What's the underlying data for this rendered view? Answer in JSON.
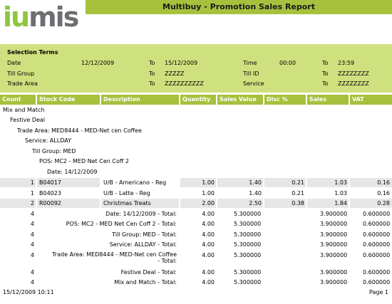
{
  "report": {
    "title": "Multibuy - Promotion Sales Report",
    "logo_part1": "iu",
    "logo_part2": "mis"
  },
  "selection": {
    "heading": "Selection Terms",
    "date_label": "Date",
    "date_from": "12/12/2009",
    "to1": "To",
    "date_to": "15/12/2009",
    "time_label": "Time",
    "time_from": "00:00",
    "to2": "To",
    "time_to": "23:59",
    "till_group_label": "Till Group",
    "to3": "To",
    "till_group_to": "ZZZZZ",
    "till_id_label": "Till ID",
    "to4": "To",
    "till_id_to": "ZZZZZZZZ",
    "trade_area_label": "Trade Area",
    "to5": "To",
    "trade_area_to": "ZZZZZZZZZZ",
    "service_label": "Service",
    "to6": "To",
    "service_to": "ZZZZZZZZ"
  },
  "columns": [
    "Count",
    "Stock Code",
    "Description",
    "Quantity",
    "Sales Value",
    "Disc %",
    "Sales",
    "VAT"
  ],
  "groups": {
    "g1": "Mix and Match",
    "g2": "Festive Deal",
    "g3": "Trade Area: MED8444 - MED-Net cen Coffee",
    "g4": "Service: ALLDAY",
    "g5": "Till Group: MED",
    "g6": "POS: MC2 - MED Net Cen Coff 2",
    "g7": "Date: 14/12/2009"
  },
  "items": [
    {
      "count": "1",
      "code": "B04017",
      "desc": "U/B - Americano - Reg",
      "qty": "1.00",
      "value": "1.40",
      "disc": "0.21",
      "sales": "1.03",
      "vat": "0.16"
    },
    {
      "count": "1",
      "code": "B04023",
      "desc": "U/B - Latte - Reg",
      "qty": "1.00",
      "value": "1.40",
      "disc": "0.21",
      "sales": "1.03",
      "vat": "0.16"
    },
    {
      "count": "2",
      "code": "R00092",
      "desc": "Christmas Treats",
      "qty": "2.00",
      "value": "2.50",
      "disc": "0.38",
      "sales": "1.84",
      "vat": "0.28"
    }
  ],
  "totals": [
    {
      "count": "4",
      "label": "Date: 14/12/2009 - Total:",
      "qty": "4.00",
      "value": "5.300000",
      "sales": "3.900000",
      "vat": "0.600000"
    },
    {
      "count": "4",
      "label": "POS: MC2 - MED Net Cen Coff 2 - Total:",
      "qty": "4.00",
      "value": "5.300000",
      "sales": "3.900000",
      "vat": "0.600000"
    },
    {
      "count": "4",
      "label": "Till Group: MED - Total:",
      "qty": "4.00",
      "value": "5.300000",
      "sales": "3.900000",
      "vat": "0.600000"
    },
    {
      "count": "4",
      "label": "Service: ALLDAY - Total:",
      "qty": "4.00",
      "value": "5.300000",
      "sales": "3.900000",
      "vat": "0.600000"
    },
    {
      "count": "4",
      "label": "Trade Area: MED8444 - MED-Net cen Coffee - Total:",
      "qty": "4.00",
      "value": "5.300000",
      "sales": "3.900000",
      "vat": "0.600000"
    },
    {
      "count": "4",
      "label": "Festive Deal - Total:",
      "qty": "4.00",
      "value": "5.300000",
      "sales": "3.900000",
      "vat": "0.600000"
    },
    {
      "count": "4",
      "label": "Mix and Match - Total:",
      "qty": "4.00",
      "value": "5.300000",
      "sales": "3.900000",
      "vat": "0.600000"
    }
  ],
  "footer": {
    "printed": "15/12/2009 10:11",
    "page": "Page 1"
  },
  "colors": {
    "brand_green": "#a7c13d",
    "selection_bg": "#cfe07e",
    "logo_green": "#8dc63f",
    "logo_grey": "#6d6e71"
  }
}
